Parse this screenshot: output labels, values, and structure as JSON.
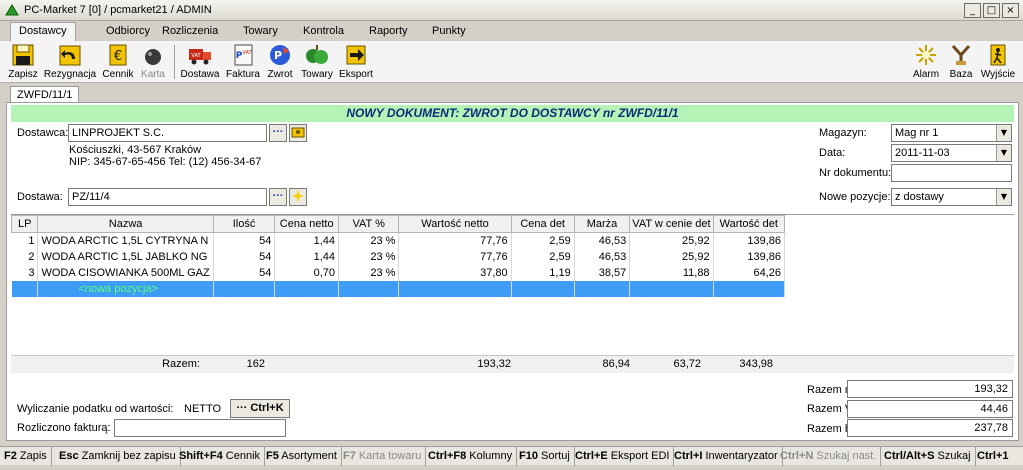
{
  "window": {
    "title": "PC-Market 7 [0] / pcmarket21 / ADMIN",
    "buttons": {
      "minimize": "_",
      "maximize": "□",
      "close": "×"
    }
  },
  "menu": [
    "Dostawcy",
    "Odbiorcy",
    "Rozliczenia",
    "Towary",
    "Kontrola",
    "Raporty",
    "Punkty"
  ],
  "toolbar": {
    "left": [
      {
        "label": "Zapisz",
        "icon": "save-icon"
      },
      {
        "label": "Rezygnacja",
        "icon": "undo-icon"
      },
      {
        "label": "Cennik",
        "icon": "price-list-icon"
      },
      {
        "label": "Karta",
        "icon": "card-icon"
      },
      {
        "label": "Dostawa",
        "icon": "delivery-truck-icon"
      },
      {
        "label": "Faktura",
        "icon": "invoice-icon"
      },
      {
        "label": "Zwrot",
        "icon": "return-icon"
      },
      {
        "label": "Towary",
        "icon": "goods-icon"
      },
      {
        "label": "Eksport",
        "icon": "export-icon"
      }
    ],
    "right": [
      {
        "label": "Alarm",
        "icon": "alarm-icon"
      },
      {
        "label": "Baza",
        "icon": "database-icon"
      },
      {
        "label": "Wyjście",
        "icon": "exit-icon"
      }
    ]
  },
  "doc_tab": "ZWFD/11/1",
  "banner": "NOWY DOKUMENT: ZWROT DO DOSTAWCY nr ZWFD/11/1",
  "supplier": {
    "label": "Dostawca:",
    "name": "LINPROJEKT S.C.",
    "address": "Kościuszki, 43-567 Kraków",
    "nip": "NIP: 345-67-65-456 Tel: (12) 456-34-67",
    "btn_dots": "···"
  },
  "delivery": {
    "label": "Dostawa:",
    "value": "PZ/11/4",
    "btn_dots": "···"
  },
  "right_fields": {
    "magazyn": {
      "label": "Magazyn:",
      "value": "Mag nr 1"
    },
    "data": {
      "label": "Data:",
      "value": "2011-11-03"
    },
    "nr_dok": {
      "label": "Nr dokumentu:",
      "value": ""
    },
    "nowe": {
      "label": "Nowe pozycje:",
      "value": "z dostawy"
    }
  },
  "table": {
    "columns": [
      "LP",
      "Nazwa",
      "Ilość",
      "Cena netto",
      "VAT %",
      "Wartość netto",
      "Cena det",
      "Marża",
      "VAT w cenie det",
      "Wartość det"
    ],
    "rows": [
      [
        "1",
        "WODA ARCTIC 1,5L CYTRYNA N",
        "54",
        "1,44",
        "23 %",
        "77,76",
        "2,59",
        "46,53",
        "25,92",
        "139,86"
      ],
      [
        "2",
        "WODA ARCTIC 1,5L JABLKO NG",
        "54",
        "1,44",
        "23 %",
        "77,76",
        "2,59",
        "46,53",
        "25,92",
        "139,86"
      ],
      [
        "3",
        "WODA CISOWIANKA 500ML GAZ",
        "54",
        "0,70",
        "23 %",
        "37,80",
        "1,19",
        "38,57",
        "11,88",
        "64,26"
      ]
    ],
    "new_row": "<nowa pozycja>"
  },
  "totals": {
    "label": "Razem:",
    "ilosc": "162",
    "wartosc_netto": "193,32",
    "marza": "86,94",
    "vat_det": "63,72",
    "wartosc_det": "343,98"
  },
  "tax": {
    "label": "Wyliczanie podatku od wartości:",
    "value": "NETTO",
    "btn": "··· Ctrl+K"
  },
  "invoice": {
    "label": "Rozliczono fakturą:",
    "value": ""
  },
  "summary": {
    "netto": {
      "label": "Razem netto:",
      "value": "193,32"
    },
    "vat": {
      "label": "Razem VAT:",
      "value": "44,46"
    },
    "brutto": {
      "label": "Razem brutto:",
      "value": "237,78"
    }
  },
  "shortcuts": [
    {
      "key": "F2",
      "label": "Zapis"
    },
    {
      "key": "Esc",
      "label": "Zamknij bez zapisu"
    },
    {
      "key": "Shift+F4",
      "label": "Cennik"
    },
    {
      "key": "F5",
      "label": "Asortyment"
    },
    {
      "key": "F7",
      "label": "Karta towaru",
      "disabled": true
    },
    {
      "key": "Ctrl+F8",
      "label": "Kolumny"
    },
    {
      "key": "F10",
      "label": "Sortuj"
    },
    {
      "key": "Ctrl+E",
      "label": "Eksport EDI"
    },
    {
      "key": "Ctrl+I",
      "label": "Inwentaryzator"
    },
    {
      "key": "Ctrl+N",
      "label": "Szukaj nast.",
      "disabled": true
    },
    {
      "key": "Ctrl/Alt+S",
      "label": "Szukaj"
    },
    {
      "key": "Ctrl+1",
      "label": ""
    }
  ]
}
